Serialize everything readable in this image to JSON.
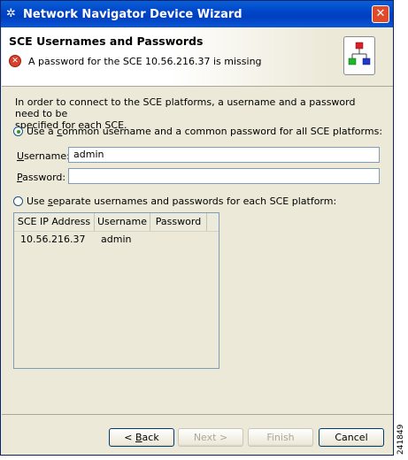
{
  "window": {
    "title": "Network Navigator Device Wizard",
    "close_glyph": "✕",
    "app_icon": "network-icon"
  },
  "header": {
    "title": "SCE Usernames and Passwords",
    "error_message": "A password for the SCE 10.56.216.37 is missing",
    "error_glyph": "✕"
  },
  "body": {
    "intro_line1": "In order to connect to the SCE platforms, a username and a password need to be",
    "intro_line2": "specified for each SCE.",
    "common_option": {
      "pre": "Use a ",
      "ul": "c",
      "post": "ommon username and a common password for all SCE platforms:",
      "checked": true
    },
    "username_label": {
      "ul": "U",
      "post": "sername:"
    },
    "username_value": "admin",
    "password_label": {
      "ul": "P",
      "post": "assword:"
    },
    "password_value": "",
    "separate_option": {
      "pre": "Use ",
      "ul": "s",
      "post": "eparate usernames and passwords for each SCE platform:",
      "checked": false
    }
  },
  "table": {
    "columns": [
      "SCE IP Address",
      "Username",
      "Password"
    ],
    "rows": [
      {
        "ip": "10.56.216.37",
        "username": "admin",
        "password": ""
      }
    ]
  },
  "buttons": {
    "back": {
      "pre": "< ",
      "ul": "B",
      "post": "ack"
    },
    "next": "Next >",
    "finish": "Finish",
    "cancel": "Cancel"
  },
  "side_code": "241849",
  "colors": {
    "titlebar": "#0046c8",
    "dialog": "#ece9d8",
    "error": "#d6412b"
  }
}
